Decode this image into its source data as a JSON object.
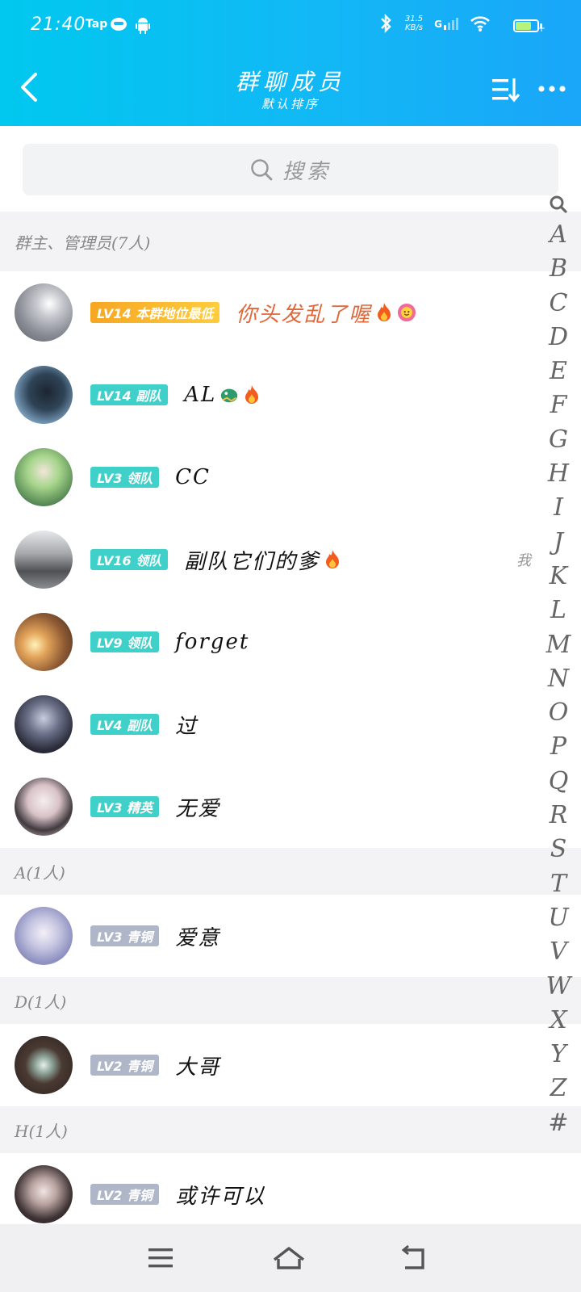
{
  "status_bar": {
    "time": "21:40",
    "app_label": "Tap",
    "net_speed_value": "31.5",
    "net_speed_unit": "KB/s",
    "signal_label": "G",
    "icons": [
      "app-face-icon",
      "android-icon",
      "bluetooth-icon",
      "signal-icon",
      "wifi-icon",
      "battery-icon"
    ]
  },
  "header": {
    "title": "群聊成员",
    "subtitle": "默认排序"
  },
  "search": {
    "placeholder": "搜索"
  },
  "sections": [
    {
      "label": "群主、管理员(7人)",
      "members": [
        {
          "badge": "LV14 本群地位最低",
          "badge_style": "gold",
          "name": "你头发乱了喔",
          "avatar_color": "#9fa4ad"
        },
        {
          "badge": "LV14 副队",
          "badge_style": "teal",
          "name": "AL",
          "avatar_color": "#4d6a83"
        },
        {
          "badge": "LV3 领队",
          "badge_style": "teal",
          "name": "CC",
          "avatar_color": "#9cc77c"
        },
        {
          "badge": "LV16 领队",
          "badge_style": "teal",
          "name": "副队它们的爹",
          "avatar_color": "#7a7b80",
          "tag": "我"
        },
        {
          "badge": "LV9 领队",
          "badge_style": "teal",
          "name": "forget",
          "avatar_color": "#c28a4c"
        },
        {
          "badge": "LV4 副队",
          "badge_style": "teal",
          "name": "过",
          "avatar_color": "#3a3d4d"
        },
        {
          "badge": "LV3 精英",
          "badge_style": "teal",
          "name": "无爱",
          "avatar_color": "#cfbfc3"
        }
      ]
    },
    {
      "label": "A(1人)",
      "members": [
        {
          "badge": "LV3 青铜",
          "badge_style": "gray",
          "name": "爱意",
          "avatar_color": "#bfc3dd"
        }
      ]
    },
    {
      "label": "D(1人)",
      "members": [
        {
          "badge": "LV2 青铜",
          "badge_style": "gray",
          "name": "大哥",
          "avatar_color": "#4a3a33"
        }
      ]
    },
    {
      "label": "H(1人)",
      "members": [
        {
          "badge": "LV2 青铜",
          "badge_style": "gray",
          "name": "或许可以",
          "avatar_color": "#3d3234"
        }
      ]
    }
  ],
  "index_letters": [
    "A",
    "B",
    "C",
    "D",
    "E",
    "F",
    "G",
    "H",
    "I",
    "J",
    "K",
    "L",
    "M",
    "N",
    "O",
    "P",
    "Q",
    "R",
    "S",
    "T",
    "U",
    "V",
    "W",
    "X",
    "Y",
    "Z",
    "#"
  ],
  "colors": {
    "header_start": "#00c8ef",
    "header_end": "#1aa6f9",
    "badge_teal": "#3fd0c9",
    "badge_gray": "#aeb6c8",
    "badge_gold": "#f6a623",
    "owner_name": "#e0673a"
  }
}
